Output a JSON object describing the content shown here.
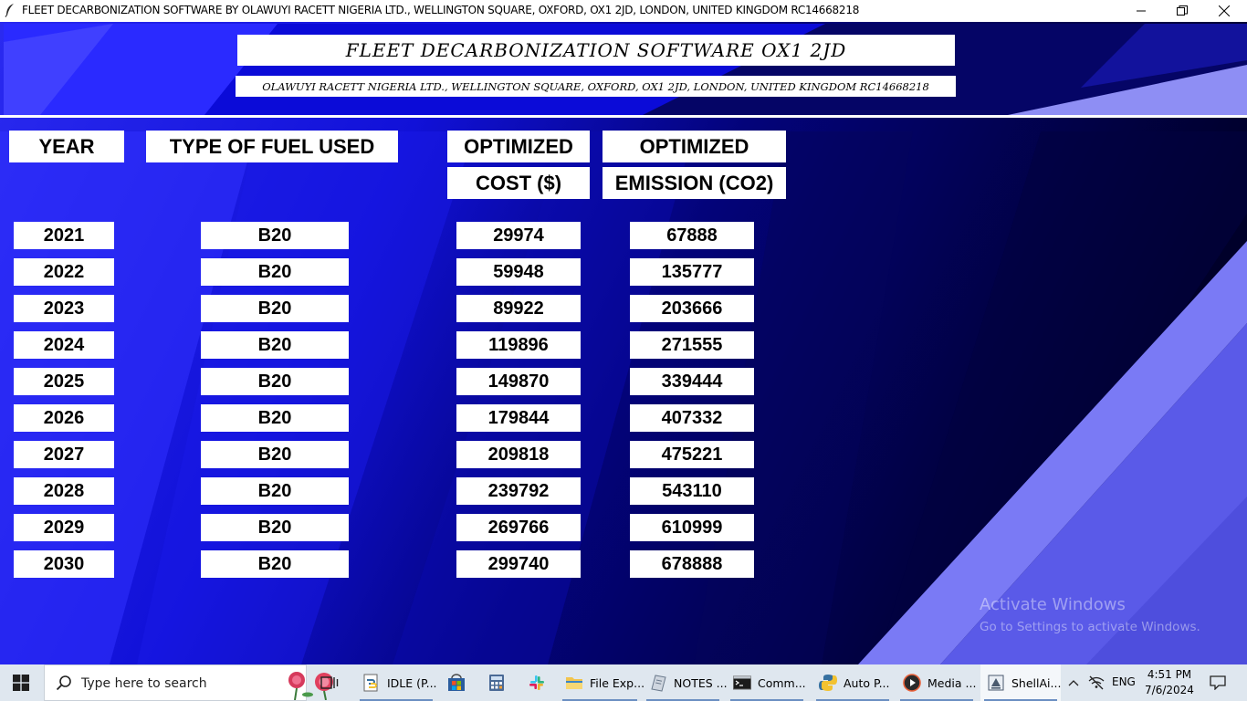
{
  "window": {
    "title": "FLEET DECARBONIZATION SOFTWARE BY OLAWUYI RACETT NIGERIA LTD., WELLINGTON SQUARE, OXFORD, OX1 2JD, LONDON, UNITED KINGDOM RC14668218",
    "icon": "feather-icon",
    "controls": [
      "minimize",
      "restore",
      "close"
    ]
  },
  "banner": {
    "title": "FLEET DECARBONIZATION SOFTWARE OX1 2JD",
    "subtitle": "OLAWUYI RACETT NIGERIA LTD., WELLINGTON SQUARE, OXFORD, OX1 2JD, LONDON, UNITED KINGDOM RC14668218"
  },
  "headers": {
    "year": "YEAR",
    "fuel": "TYPE OF FUEL USED",
    "cost_top": "OPTIMIZED",
    "cost_bottom": "COST ($)",
    "emission_top": "OPTIMIZED",
    "emission_bottom": "EMISSION (CO2)"
  },
  "rows": [
    {
      "year": "2021",
      "fuel": "B20",
      "cost": "29974",
      "emission": "67888"
    },
    {
      "year": "2022",
      "fuel": "B20",
      "cost": "59948",
      "emission": "135777"
    },
    {
      "year": "2023",
      "fuel": "B20",
      "cost": "89922",
      "emission": "203666"
    },
    {
      "year": "2024",
      "fuel": "B20",
      "cost": "119896",
      "emission": "271555"
    },
    {
      "year": "2025",
      "fuel": "B20",
      "cost": "149870",
      "emission": "339444"
    },
    {
      "year": "2026",
      "fuel": "B20",
      "cost": "179844",
      "emission": "407332"
    },
    {
      "year": "2027",
      "fuel": "B20",
      "cost": "209818",
      "emission": "475221"
    },
    {
      "year": "2028",
      "fuel": "B20",
      "cost": "239792",
      "emission": "543110"
    },
    {
      "year": "2029",
      "fuel": "B20",
      "cost": "269766",
      "emission": "610999"
    },
    {
      "year": "2030",
      "fuel": "B20",
      "cost": "299740",
      "emission": "678888"
    }
  ],
  "watermark": {
    "line1": "Activate Windows",
    "line2": "Go to Settings to activate Windows."
  },
  "taskbar": {
    "search_placeholder": "Type here to search",
    "apps": [
      {
        "label": "IDLE (P...",
        "icon": "python-idle-icon"
      },
      {
        "label": "",
        "icon": "microsoft-store-icon"
      },
      {
        "label": "",
        "icon": "calculator-icon"
      },
      {
        "label": "",
        "icon": "slack-icon"
      },
      {
        "label": "File Exp...",
        "icon": "folder-icon"
      },
      {
        "label": "NOTES ...",
        "icon": "notes-icon"
      },
      {
        "label": "Comm...",
        "icon": "terminal-icon"
      },
      {
        "label": "Auto P...",
        "icon": "python-icon"
      },
      {
        "label": "Media ...",
        "icon": "media-player-icon"
      },
      {
        "label": "ShellAi...",
        "icon": "shell-app-icon"
      }
    ],
    "language": "ENG",
    "time": "4:51 PM",
    "date": "7/6/2024"
  },
  "colors": {
    "background_blue": "#1414f5",
    "background_dark": "#000040",
    "stripe_light": "#8484f8",
    "cell_bg": "#ffffff",
    "taskbar_bg": "#dfe7ef"
  }
}
